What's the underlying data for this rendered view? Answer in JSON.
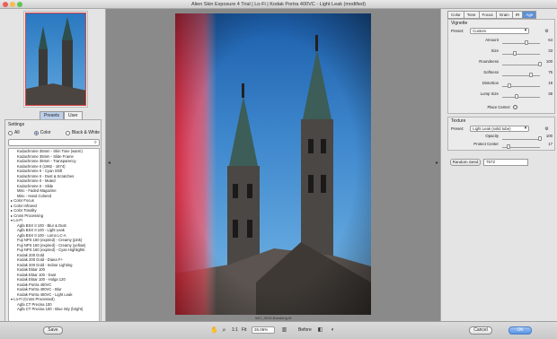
{
  "window": {
    "title": "Alien Skin Exposure 4 Trial | Lo-Fi | Kodak Portra 400VC - Light Leak (modified)",
    "controls": {
      "close_color": "#ec5f57",
      "minimize_color": "#f5be4f",
      "zoom_color": "#5fc454"
    }
  },
  "left_panel": {
    "tabs": [
      {
        "label": "Presets",
        "active": true
      },
      {
        "label": "User",
        "active": false
      }
    ],
    "settings_label": "Settings",
    "filter": [
      {
        "label": "All",
        "selected": false
      },
      {
        "label": "Color",
        "selected": true
      },
      {
        "label": "Black & White",
        "selected": false
      }
    ],
    "search": {
      "value": "",
      "placeholder": "",
      "icon": "search-icon"
    },
    "presets": [
      {
        "label": "Kodachrome 35mm - Skin Tone (warm)",
        "group": false
      },
      {
        "label": "Kodachrome 35mm - Slide Frame",
        "group": false
      },
      {
        "label": "Kodachrome 35mm - Transparency",
        "group": false
      },
      {
        "label": "Kodachrome II (1962 - 1974)",
        "group": false
      },
      {
        "label": "Kodachrome II - Cyan Shift",
        "group": false
      },
      {
        "label": "Kodachrome II - Dust & Scratches",
        "group": false
      },
      {
        "label": "Kodachrome II - Muted",
        "group": false
      },
      {
        "label": "Kodachrome II - Slide",
        "group": false
      },
      {
        "label": "Misc - Faded Magazine",
        "group": false
      },
      {
        "label": "Misc - Hand Colored",
        "group": false
      },
      {
        "label": "▸ Color Focus",
        "group": true
      },
      {
        "label": "▸ Color Infrared",
        "group": true
      },
      {
        "label": "▸ Color Tonality",
        "group": true
      },
      {
        "label": "▸ Cross Processing",
        "group": true
      },
      {
        "label": "▾ Lo-Fi",
        "group": true
      },
      {
        "label": "Agfa BSX II 100 - Blur & Dust",
        "group": false
      },
      {
        "label": "Agfa BSX II 100 - Light Leak",
        "group": false
      },
      {
        "label": "Agfa BSX II 100 - Lomo LC-A",
        "group": false
      },
      {
        "label": "Fuji NPS 160 (expired) - Creamy (pink)",
        "group": false
      },
      {
        "label": "Fuji NPS 160 (expired) - Creamy (yellow)",
        "group": false
      },
      {
        "label": "Fuji NPS 160 (expired) - Cyan Highlights",
        "group": false
      },
      {
        "label": "Kodak 200 Gold",
        "group": false
      },
      {
        "label": "Kodak 200 Gold - Diana F+",
        "group": false
      },
      {
        "label": "Kodak 200 Gold - Indoor Lighting",
        "group": false
      },
      {
        "label": "Kodak Ektar 100",
        "group": false
      },
      {
        "label": "Kodak Ektar 100 - Dust",
        "group": false
      },
      {
        "label": "Kodak Ektar 100 - Holga 120",
        "group": false
      },
      {
        "label": "Kodak Portra 400VC",
        "group": false
      },
      {
        "label": "Kodak Portra 400VC - Blur",
        "group": false
      },
      {
        "label": "Kodak Portra 400VC - Light Leak",
        "group": false
      },
      {
        "label": "▾ Lo-Fi (Cross Processed)",
        "group": true
      },
      {
        "label": "Agfa CT Precisa 100",
        "group": false
      },
      {
        "label": "Agfa CT Precisa 100 - Blue Sky (bright)",
        "group": false
      }
    ]
  },
  "canvas": {
    "caption": "IMG_9519-Bamberg.tif",
    "sky_top": "#1c5eab",
    "sky_bottom": "#7ab6e4",
    "light_leak_color": "#ff2a3c"
  },
  "right_panel": {
    "tabs": [
      {
        "label": "Color",
        "active": false
      },
      {
        "label": "Tone",
        "active": false
      },
      {
        "label": "Focus",
        "active": false
      },
      {
        "label": "Grain",
        "active": false
      },
      {
        "label": "IR",
        "active": false
      },
      {
        "label": "Age",
        "active": true
      }
    ],
    "vignette": {
      "title": "Vignette",
      "preset_label": "Preset:",
      "preset_value": "Custom",
      "sliders": [
        {
          "label": "Amount",
          "value": "64",
          "fraction": 0.64
        },
        {
          "label": "Size",
          "value": "33",
          "fraction": 0.33
        },
        {
          "label": "Roundness",
          "value": "100",
          "fraction": 1.0
        },
        {
          "label": "Softness",
          "value": "75",
          "fraction": 0.75
        },
        {
          "label": "Distortion",
          "value": "19",
          "fraction": 0.19
        },
        {
          "label": "Lump Size",
          "value": "38",
          "fraction": 0.38
        }
      ],
      "place_center_label": "Place Center:"
    },
    "texture": {
      "title": "Texture",
      "preset_label": "Preset:",
      "preset_value": "Light Leak (solid tube)",
      "sliders": [
        {
          "label": "Opacity",
          "value": "100",
          "fraction": 1.0
        },
        {
          "label": "Protect Center",
          "value": "17",
          "fraction": 0.17
        }
      ]
    },
    "random_seed": {
      "button_label": "Random Seed",
      "value": "7572"
    }
  },
  "bottom_bar": {
    "save_label": "Save",
    "cancel_label": "Cancel",
    "ok_label": "OK",
    "zoom_ratio": "1:1",
    "fit_label": "Fit",
    "zoom_percent": "26.06%",
    "before_label": "Before"
  }
}
